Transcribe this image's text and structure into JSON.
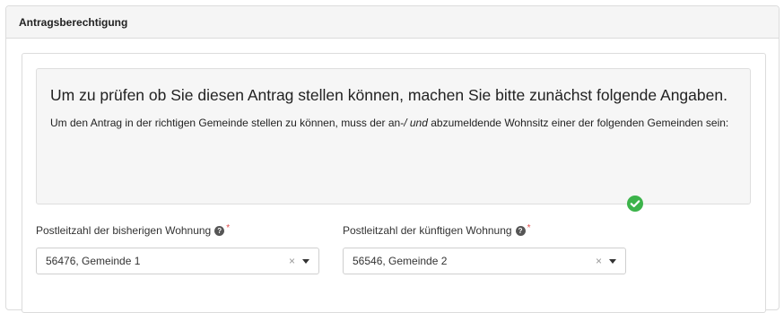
{
  "panel": {
    "title": "Antragsberechtigung"
  },
  "info": {
    "heading": "Um zu prüfen ob Sie diesen Antrag stellen können, machen Sie bitte zunächst folgende Angaben.",
    "text_before": "Um den Antrag in der richtigen Gemeinde stellen zu können, muss der an-",
    "text_italic": "/ und",
    "text_after": " abzumeldende Wohnsitz einer der folgenden Gemeinden sein:"
  },
  "fields": {
    "previous": {
      "label": "Postleitzahl der bisherigen Wohnung",
      "value": "56476, Gemeinde 1",
      "required_marker": "*",
      "help_icon": "question-circle-icon",
      "clear_icon": "×"
    },
    "future": {
      "label": "Postleitzahl der künftigen Wohnung",
      "value": "56546, Gemeinde 2",
      "required_marker": "*",
      "help_icon": "question-circle-icon",
      "clear_icon": "×"
    }
  },
  "status": {
    "icon": "check-circle-icon",
    "color": "#3cb34a"
  }
}
